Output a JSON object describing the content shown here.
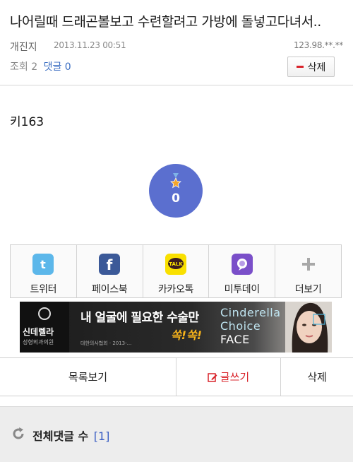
{
  "post": {
    "title": "나어릴때 드래곤볼보고 수련할려고 가방에 돌넣고다녀서..",
    "author": "개진지",
    "date": "2013.11.23 00:51",
    "ip": "123.98.**.**",
    "views_label": "조회 2",
    "comments_label": "댓글 0",
    "delete_small_label": "삭제",
    "body": "키163"
  },
  "like": {
    "count": "0"
  },
  "share": {
    "items": [
      {
        "label": "트위터",
        "icon": "twitter-icon",
        "color": "#1da1f2"
      },
      {
        "label": "페이스북",
        "icon": "facebook-icon",
        "color": "#3b5998"
      },
      {
        "label": "카카오톡",
        "icon": "kakaotalk-icon",
        "color": "#f9e000"
      },
      {
        "label": "미투데이",
        "icon": "metoday-icon",
        "color": "#7a4fc9"
      },
      {
        "label": "더보기",
        "icon": "plus-icon",
        "color": "#9a9a9a"
      }
    ]
  },
  "ad": {
    "brand_ko": "신데렐라",
    "brand_sub": "성형외과의원",
    "headline": "내 얼굴에 필요한 수술만",
    "slogan": "쏙!쏙!",
    "fineprint": "대한의사협회 · 2013-...",
    "brand_en_1": "Cinderella",
    "brand_en_2": "Choice",
    "brand_en_3": "FACE"
  },
  "actions": {
    "list_label": "목록보기",
    "write_label": "글쓰기",
    "delete_label": "삭제"
  },
  "comments": {
    "title": "전체댓글 수",
    "count": "[1]"
  },
  "colors": {
    "accent_blue": "#3b6ec2",
    "like_circle": "#5b6fcf",
    "red": "#d9232a"
  }
}
